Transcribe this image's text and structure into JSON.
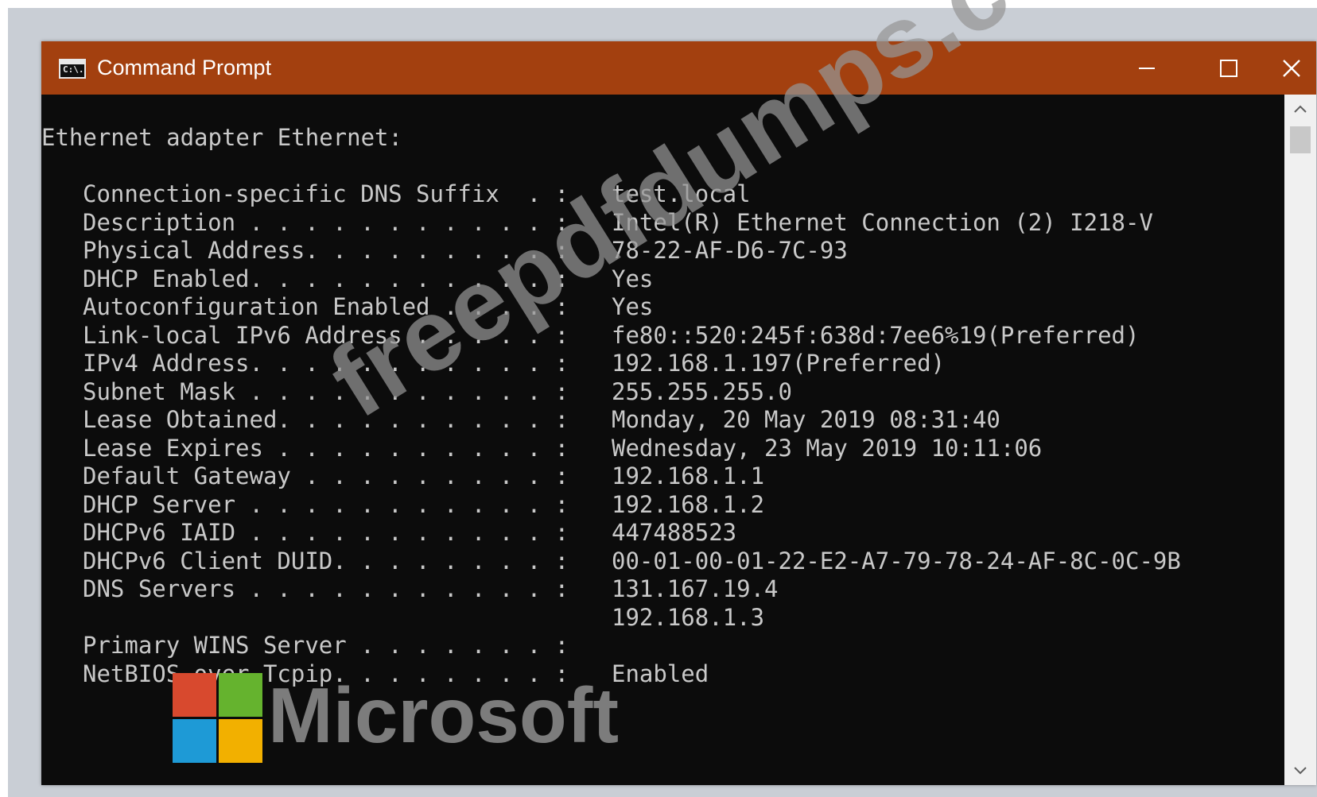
{
  "window": {
    "title": "Command Prompt",
    "icon_label": "C:\\.",
    "controls": [
      "minimize",
      "maximize",
      "close"
    ],
    "titlebar_color": "#a3400f"
  },
  "console": {
    "adapter_header": "Ethernet adapter Ethernet:",
    "rows": [
      {
        "label": "Connection-specific DNS Suffix  . :",
        "value": "test.local"
      },
      {
        "label": "Description . . . . . . . . . . . :",
        "value": "Intel(R) Ethernet Connection (2) I218-V"
      },
      {
        "label": "Physical Address. . . . . . . . . :",
        "value": "78-22-AF-D6-7C-93"
      },
      {
        "label": "DHCP Enabled. . . . . . . . . . . :",
        "value": "Yes"
      },
      {
        "label": "Autoconfiguration Enabled . . . . :",
        "value": "Yes"
      },
      {
        "label": "Link-local IPv6 Address . . . . . :",
        "value": "fe80::520:245f:638d:7ee6%19(Preferred)"
      },
      {
        "label": "IPv4 Address. . . . . . . . . . . :",
        "value": "192.168.1.197(Preferred)"
      },
      {
        "label": "Subnet Mask . . . . . . . . . . . :",
        "value": "255.255.255.0"
      },
      {
        "label": "Lease Obtained. . . . . . . . . . :",
        "value": "Monday, 20 May 2019 08:31:40"
      },
      {
        "label": "Lease Expires . . . . . . . . . . :",
        "value": "Wednesday, 23 May 2019 10:11:06"
      },
      {
        "label": "Default Gateway . . . . . . . . . :",
        "value": "192.168.1.1"
      },
      {
        "label": "DHCP Server . . . . . . . . . . . :",
        "value": "192.168.1.2"
      },
      {
        "label": "DHCPv6 IAID . . . . . . . . . . . :",
        "value": "447488523"
      },
      {
        "label": "DHCPv6 Client DUID. . . . . . . . :",
        "value": "00-01-00-01-22-E2-A7-79-78-24-AF-8C-0C-9B"
      },
      {
        "label": "DNS Servers . . . . . . . . . . . :",
        "value": "131.167.19.4"
      },
      {
        "label": "",
        "value": "192.168.1.3"
      },
      {
        "label": "Primary WINS Server . . . . . . . :",
        "value": ""
      },
      {
        "label": "NetBIOS over Tcpip. . . . . . . . :",
        "value": "Enabled"
      }
    ]
  },
  "watermark": "freepdfdumps.com",
  "logo": {
    "text": "Microsoft",
    "colors": [
      "#d8492e",
      "#65b32e",
      "#1e9ad6",
      "#f2b000"
    ]
  }
}
